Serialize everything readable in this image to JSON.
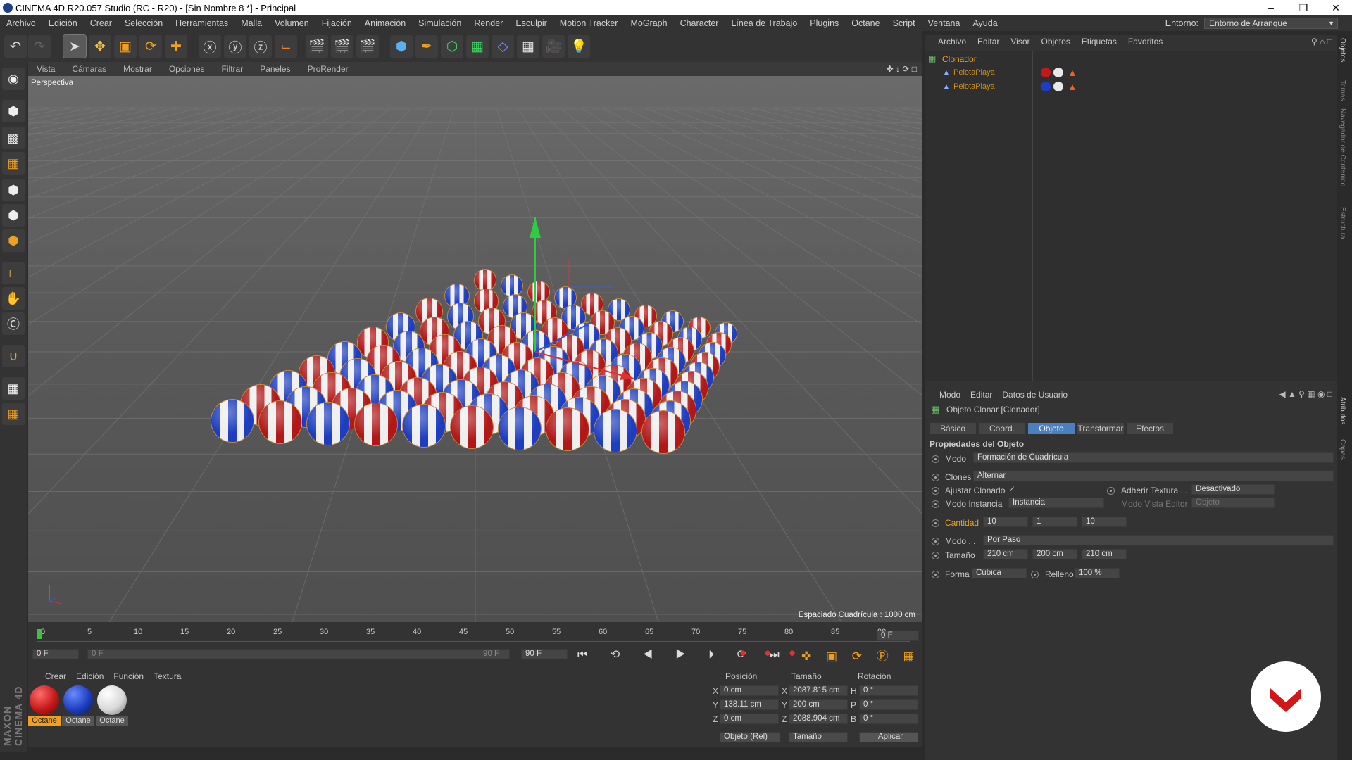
{
  "window": {
    "title": "CINEMA 4D R20.057 Studio (RC - R20) - [Sin Nombre 8 *] - Principal",
    "min_icon": "minimize-icon",
    "max_icon": "restore-icon",
    "close_icon": "close-icon"
  },
  "menubar": {
    "items": [
      "Archivo",
      "Edición",
      "Crear",
      "Selección",
      "Herramientas",
      "Malla",
      "Volumen",
      "Fijación",
      "Animación",
      "Simulación",
      "Render",
      "Esculpir",
      "Motion Tracker",
      "MoGraph",
      "Character",
      "Línea de Trabajo",
      "Plugins",
      "Octane",
      "Script",
      "Ventana",
      "Ayuda"
    ],
    "env_label": "Entorno:",
    "env_value": "Entorno de Arranque"
  },
  "viewport": {
    "menu": [
      "Vista",
      "Cámaras",
      "Mostrar",
      "Opciones",
      "Filtrar",
      "Paneles",
      "ProRender"
    ],
    "camera": "Perspectiva",
    "grid_spacing": "Espaciado Cuadrícula : 1000 cm"
  },
  "timeline": {
    "ticks": [
      "0",
      "5",
      "10",
      "15",
      "20",
      "25",
      "30",
      "35",
      "40",
      "45",
      "50",
      "55",
      "60",
      "65",
      "70",
      "75",
      "80",
      "85",
      "90"
    ],
    "end_frame": "0 F",
    "current": "0 F",
    "range_start": "0 F",
    "range_end": "90 F",
    "max": "90 F"
  },
  "material_manager": {
    "menu": [
      "Crear",
      "Edición",
      "Función",
      "Textura"
    ],
    "materials": [
      {
        "name": "Octane",
        "color": "#c41818"
      },
      {
        "name": "Octane",
        "color": "#1d3ec0"
      },
      {
        "name": "Octane",
        "color": "#e8e8e8"
      }
    ]
  },
  "coords": {
    "headers": [
      "Posición",
      "Tamaño",
      "Rotación"
    ],
    "rows": [
      {
        "axis": "X",
        "pos": "0 cm",
        "size_axis": "X",
        "size": "2087.815 cm",
        "rot_axis": "H",
        "rot": "0 °"
      },
      {
        "axis": "Y",
        "pos": "138.11 cm",
        "size_axis": "Y",
        "size": "200 cm",
        "rot_axis": "P",
        "rot": "0 °"
      },
      {
        "axis": "Z",
        "pos": "0 cm",
        "size_axis": "Z",
        "size": "2088.904 cm",
        "rot_axis": "B",
        "rot": "0 °"
      }
    ],
    "mode": "Objeto (Rel)",
    "size_mode": "Tamaño",
    "apply": "Aplicar"
  },
  "object_manager": {
    "menu": [
      "Archivo",
      "Editar",
      "Visor",
      "Objetos",
      "Etiquetas",
      "Favoritos"
    ],
    "objects": [
      {
        "name": "Clonador",
        "level": 0
      },
      {
        "name": "PelotaPlaya",
        "level": 1
      },
      {
        "name": "PelotaPlaya",
        "level": 1
      }
    ]
  },
  "attributes": {
    "menu": [
      "Modo",
      "Editar",
      "Datos de Usuario"
    ],
    "object_title": "Objeto Clonar [Clonador]",
    "tabs": [
      "Básico",
      "Coord.",
      "Objeto",
      "Transformar",
      "Efectos"
    ],
    "active_tab": "Objeto",
    "section": "Propiedades del Objeto",
    "modo_label": "Modo",
    "modo_value": "Formación de Cuadrícula",
    "clones_label": "Clones",
    "clones_value": "Alternar",
    "ajustar_label": "Ajustar Clonado",
    "ajustar_check": "✓",
    "adherir_label": "Adherir Textura . .",
    "adherir_value": "Desactivado",
    "instancia_label": "Modo Instancia",
    "instancia_value": "Instancia",
    "vista_label": "Modo Vista Editor",
    "vista_value": "Objeto",
    "cantidad_label": "Cantidad",
    "cantidad": [
      "10",
      "1",
      "10"
    ],
    "modo2_label": "Modo . .",
    "modo2_value": "Por Paso",
    "tamano_label": "Tamaño",
    "tamano": [
      "210 cm",
      "200 cm",
      "210 cm"
    ],
    "forma_label": "Forma",
    "forma_value": "Cúbica",
    "relleno_label": "Relleno",
    "relleno_value": "100 %"
  },
  "side_tabs": [
    "Objetos",
    "Tomas",
    "Navegador de Contenido",
    "Estructura",
    "Atributos",
    "Capas"
  ],
  "brand": "MAXON CINEMA 4D"
}
